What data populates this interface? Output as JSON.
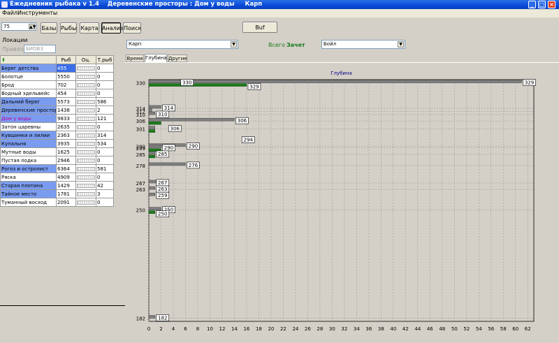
{
  "window": {
    "title": "Ежедневник рыбака v 1.4    Деревенские просторы : Дом у воды     Карп"
  },
  "menu": {
    "file": "Файл",
    "tools": "Инструменты"
  },
  "toolbar": {
    "spin_value": "75",
    "bases": "Базы",
    "fish": "Рыбы",
    "map": "Карта",
    "analysis": "Анализ",
    "search": "Поиск",
    "buf": "Buf"
  },
  "left": {
    "locations_label": "Локации",
    "filter_label": "Привязка",
    "filter_value": "БИОВЗ",
    "col_fish": "Рыб",
    "col_score": "Оц.",
    "col_trophy": "Т.рыб",
    "rows": [
      {
        "name": "Берег детства",
        "fish": "455",
        "trophy": "0",
        "style": "sel"
      },
      {
        "name": "Болотце",
        "fish": "5550",
        "trophy": "0",
        "style": ""
      },
      {
        "name": "Брод",
        "fish": "702",
        "trophy": "0",
        "style": ""
      },
      {
        "name": "Водный эдельвейс",
        "fish": "454",
        "trophy": "0",
        "style": ""
      },
      {
        "name": "Дальний берег",
        "fish": "5573",
        "trophy": "586",
        "style": "sel"
      },
      {
        "name": "Деревенские просторы",
        "fish": "1438",
        "trophy": "2",
        "style": "sel"
      },
      {
        "name": "Дом у воды",
        "fish": "9833",
        "trophy": "121",
        "style": "hl"
      },
      {
        "name": "Затон царевны",
        "fish": "2635",
        "trophy": "0",
        "style": ""
      },
      {
        "name": "Кувшинки и лилии",
        "fish": "2363",
        "trophy": "314",
        "style": "sel"
      },
      {
        "name": "Купальня",
        "fish": "3935",
        "trophy": "534",
        "style": "sel"
      },
      {
        "name": "Мутные воды",
        "fish": "1625",
        "trophy": "0",
        "style": ""
      },
      {
        "name": "Пустая лодка",
        "fish": "2946",
        "trophy": "0",
        "style": ""
      },
      {
        "name": "Рогоз и остролист",
        "fish": "6364",
        "trophy": "581",
        "style": "sel"
      },
      {
        "name": "Ряска",
        "fish": "4909",
        "trophy": "0",
        "style": ""
      },
      {
        "name": "Старая плотина",
        "fish": "1429",
        "trophy": "42",
        "style": "sel"
      },
      {
        "name": "Тайное место",
        "fish": "1781",
        "trophy": "3",
        "style": "sel"
      },
      {
        "name": "Туманный восход",
        "fish": "2091",
        "trophy": "0",
        "style": ""
      }
    ]
  },
  "right": {
    "fish_select": "Карп",
    "total_label": "Всего",
    "total_value": "Зачет",
    "bait_select": "Бойл",
    "tabs": [
      {
        "label": "Время",
        "active": false
      },
      {
        "label": "Глубина",
        "active": true
      },
      {
        "label": "Другие",
        "active": false
      }
    ]
  },
  "chart_data": {
    "type": "bar",
    "orientation": "horizontal",
    "title": "Глубина",
    "xlim": [
      0,
      63
    ],
    "xticks": [
      0,
      2,
      4,
      6,
      8,
      10,
      12,
      14,
      16,
      18,
      20,
      22,
      24,
      26,
      28,
      30,
      32,
      34,
      36,
      38,
      40,
      42,
      44,
      46,
      48,
      50,
      52,
      54,
      56,
      58,
      60,
      62
    ],
    "ylim": [
      180,
      332
    ],
    "yticks": [
      330,
      314,
      312,
      310,
      306,
      301,
      290,
      289,
      285,
      278,
      267,
      263,
      250,
      182
    ],
    "series": [
      {
        "color": "#808080",
        "values": [
          [
            330,
            5
          ],
          [
            330,
            61
          ],
          [
            314,
            2
          ],
          [
            312,
            0.5
          ],
          [
            310,
            1
          ],
          [
            306,
            14
          ],
          [
            301,
            1
          ],
          [
            290,
            6
          ],
          [
            289,
            2
          ],
          [
            285,
            1
          ],
          [
            278,
            6
          ],
          [
            267,
            2
          ],
          [
            263,
            1
          ],
          [
            259,
            1
          ],
          [
            250,
            2
          ],
          [
            182,
            1
          ]
        ],
        "labels": [
          [
            330,
            5,
            "330"
          ],
          [
            330,
            61,
            "329"
          ],
          [
            314,
            2,
            "314"
          ],
          [
            310,
            1,
            "310"
          ],
          [
            306,
            14,
            "306"
          ],
          [
            301,
            3,
            "306"
          ],
          [
            294,
            15,
            "294"
          ],
          [
            290,
            6,
            "290"
          ],
          [
            289,
            2,
            "290"
          ],
          [
            285,
            1,
            "285"
          ],
          [
            278,
            6,
            "276"
          ],
          [
            267,
            1,
            "267"
          ],
          [
            263,
            1,
            "263"
          ],
          [
            259,
            1,
            "259"
          ],
          [
            250,
            2,
            "250"
          ],
          [
            182,
            1,
            "182"
          ]
        ]
      },
      {
        "color": "#1f7a1f",
        "values": [
          [
            330,
            16
          ],
          [
            306,
            2
          ],
          [
            301,
            1
          ],
          [
            289,
            2
          ],
          [
            285,
            1
          ],
          [
            250,
            1
          ]
        ],
        "labels": [
          [
            330,
            16,
            "329"
          ],
          [
            250,
            1,
            "250"
          ]
        ]
      }
    ]
  }
}
